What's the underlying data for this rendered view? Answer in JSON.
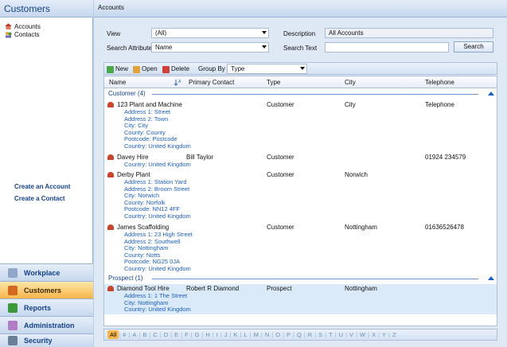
{
  "sidebar": {
    "title": "Customers",
    "tree": [
      {
        "label": "Accounts"
      },
      {
        "label": "Contacts"
      }
    ],
    "links": [
      "Create an Account",
      "Create a Contact"
    ],
    "nav": [
      {
        "label": "Workplace",
        "active": false
      },
      {
        "label": "Customers",
        "active": true
      },
      {
        "label": "Reports",
        "active": false
      },
      {
        "label": "Administration",
        "active": false
      },
      {
        "label": "Security",
        "active": false
      }
    ]
  },
  "main": {
    "title": "Accounts",
    "filters": {
      "view_label": "View",
      "view_value": "(All)",
      "description_label": "Description",
      "description_value": "All Accounts",
      "search_attr_label": "Search Attribute",
      "search_attr_value": "Name",
      "search_text_label": "Search Text",
      "search_text_value": "",
      "search_button": "Search"
    },
    "toolbar": {
      "new": "New",
      "open": "Open",
      "delete": "Delete",
      "group_by_label": "Group By",
      "group_by_value": "Type"
    },
    "columns": [
      "Name",
      "Primary Contact",
      "Type",
      "City",
      "Telephone"
    ],
    "groups": [
      {
        "label": "Customer (4)",
        "records": [
          {
            "name": "123 Plant and Machine",
            "contact": "",
            "type": "Customer",
            "city": "City",
            "telephone": "Telephone",
            "address": [
              "Address 1: Street",
              "Address 2: Town",
              "City: City",
              "County: County",
              "Postcode: Postcode",
              "Country: United Kingdom"
            ]
          },
          {
            "name": "Davey Hire",
            "contact": "Bill Taylor",
            "type": "Customer",
            "city": "",
            "telephone": "01924 234579",
            "address": [
              "Country: United Kingdom"
            ]
          },
          {
            "name": "Derby Plant",
            "contact": "",
            "type": "Customer",
            "city": "Norwich",
            "telephone": "",
            "address": [
              "Address 1: Station Yard",
              "Address 2: Broom Street",
              "City: Norwich",
              "County: Norfolk",
              "Postcode: NN12 4FF",
              "Country: United Kingdom"
            ]
          },
          {
            "name": "James Scaffolding",
            "contact": "",
            "type": "Customer",
            "city": "Nottingham",
            "telephone": "01636526478",
            "address": [
              "Address 1: 23 High Street",
              "Address 2: Southwell",
              "City: Nottingham",
              "County: Notts",
              "Postcode: NG25 0JA",
              "Country: United Kingdom"
            ]
          }
        ]
      },
      {
        "label": "Prospect (1)",
        "records": [
          {
            "name": "Diamond Tool Hire",
            "contact": "Robert R Diamond",
            "type": "Prospect",
            "city": "Nottingham",
            "telephone": "",
            "address": [
              "Address 1: 1 The Street",
              "City: Nottingham",
              "Country: United Kingdom"
            ]
          }
        ]
      }
    ],
    "alphabet": [
      "All",
      "#",
      "A",
      "B",
      "C",
      "D",
      "E",
      "F",
      "G",
      "H",
      "I",
      "J",
      "K",
      "L",
      "M",
      "N",
      "O",
      "P",
      "Q",
      "R",
      "S",
      "T",
      "U",
      "V",
      "W",
      "X",
      "Y",
      "Z"
    ]
  }
}
